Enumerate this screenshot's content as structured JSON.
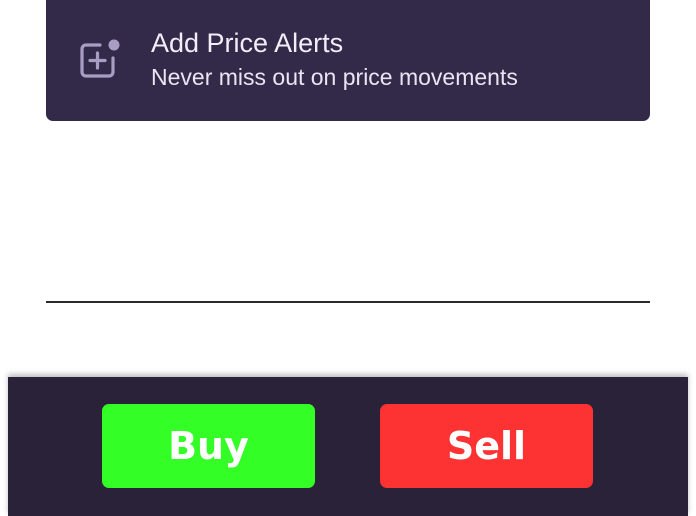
{
  "price_alert": {
    "title": "Add Price Alerts",
    "subtitle": "Never miss out on price movements",
    "icon": "add-alert-icon"
  },
  "actions": {
    "buy_label": "Buy",
    "sell_label": "Sell"
  },
  "colors": {
    "card_bg": "#332a4a",
    "bar_bg": "#2a2238",
    "buy": "#33ff26",
    "sell": "#fd3232",
    "icon": "#a99dc4"
  }
}
